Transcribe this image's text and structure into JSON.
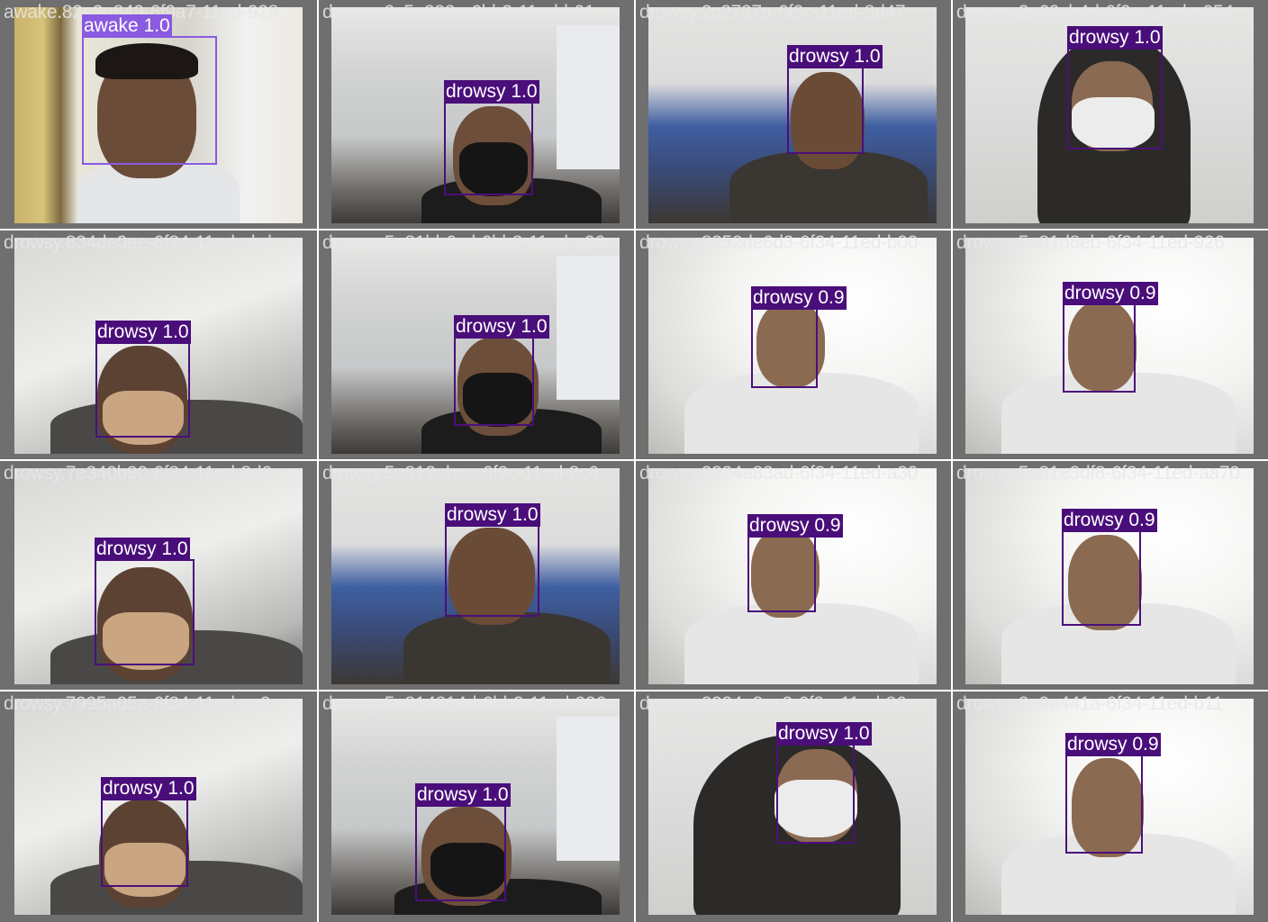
{
  "colors": {
    "grid_background": "#6f6f6f",
    "drowsy_box": "#4b0f7a",
    "drowsy_label_bg": "#4a0e7a",
    "awake_box": "#8a5ae0",
    "label_text": "#ffffff"
  },
  "tiles": [
    {
      "filename": "awake.82a9e849-6f9a7-11ed-928",
      "detection": {
        "label": "awake 1.0",
        "class": "awake",
        "confidence": 1.0
      }
    },
    {
      "filename": "drowsy.9c5e232e-6bb2-11ed-b01",
      "detection": {
        "label": "drowsy 1.0",
        "class": "drowsy",
        "confidence": 1.0
      }
    },
    {
      "filename": "drowsy.2c2737a-6f9c-11ed-8d47",
      "detection": {
        "label": "drowsy 1.0",
        "class": "drowsy",
        "confidence": 1.0
      }
    },
    {
      "filename": "drowsy.2a69cb4d-6f9a-11ed-a054",
      "detection": {
        "label": "drowsy 1.0",
        "class": "drowsy",
        "confidence": 1.0
      }
    },
    {
      "filename": "drowsy.834de0ee-6f34-11ed-abd",
      "detection": {
        "label": "drowsy 1.0",
        "class": "drowsy",
        "confidence": 1.0
      }
    },
    {
      "filename": "drowsy.5a81bb6cd-6bb2-11ed-a06",
      "detection": {
        "label": "drowsy 1.0",
        "class": "drowsy",
        "confidence": 1.0
      }
    },
    {
      "filename": "drowsy.8252de6d3-6f34-11ed-b00",
      "detection": {
        "label": "drowsy 0.9",
        "class": "drowsy",
        "confidence": 0.9
      }
    },
    {
      "filename": "drowsy.5a81d8eb-6f34-11ed-926",
      "detection": {
        "label": "drowsy 0.9",
        "class": "drowsy",
        "confidence": 0.9
      }
    },
    {
      "filename": "drowsy.7e340b90-6f34-11ed-8d6",
      "detection": {
        "label": "drowsy 1.0",
        "class": "drowsy",
        "confidence": 1.0
      }
    },
    {
      "filename": "drowsy.5a812abea-6f9c-11ed-8c6",
      "detection": {
        "label": "drowsy 1.0",
        "class": "drowsy",
        "confidence": 1.0
      }
    },
    {
      "filename": "drowsy.2324a83ad-6f34-11ed-a30",
      "detection": {
        "label": "drowsy 0.9",
        "class": "drowsy",
        "confidence": 0.9
      }
    },
    {
      "filename": "drowsy.5a81e3df8-6f34-11ed-aa70",
      "detection": {
        "label": "drowsy 0.9",
        "class": "drowsy",
        "confidence": 0.9
      }
    },
    {
      "filename": "drowsy.7995a05a-6f34-11ed-ac9",
      "detection": {
        "label": "drowsy 1.0",
        "class": "drowsy",
        "confidence": 1.0
      }
    },
    {
      "filename": "drowsy.5a814814d-6bb2-11ed-936",
      "detection": {
        "label": "drowsy 1.0",
        "class": "drowsy",
        "confidence": 1.0
      }
    },
    {
      "filename": "drowsy.2324e8ca3-6f9a-11ed-86",
      "detection": {
        "label": "drowsy 1.0",
        "class": "drowsy",
        "confidence": 1.0
      }
    },
    {
      "filename": "drowsy.2a9a441a-6f34-11ed-b11",
      "detection": {
        "label": "drowsy 0.9",
        "class": "drowsy",
        "confidence": 0.9
      }
    }
  ]
}
